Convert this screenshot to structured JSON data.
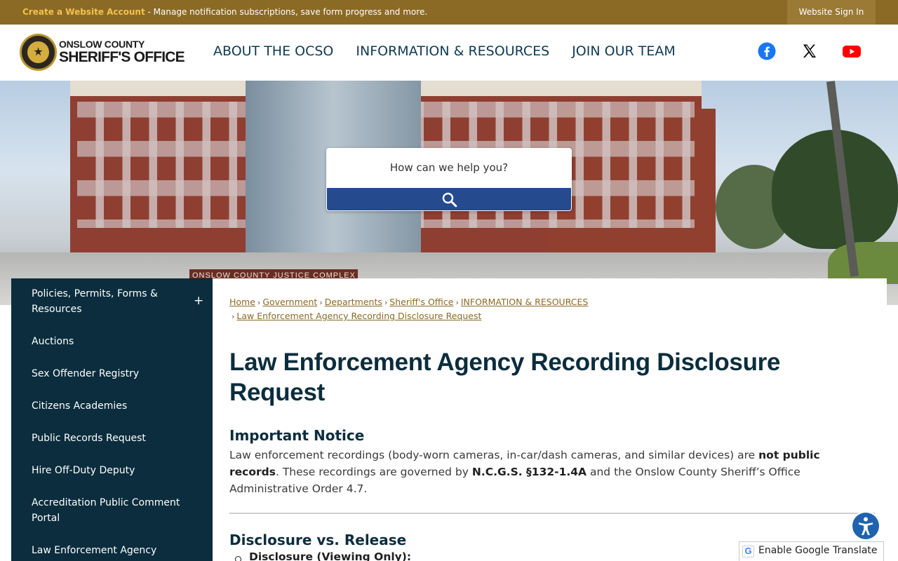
{
  "topbar": {
    "create_link": "Create a Website Account",
    "create_rest": " - Manage notification subscriptions, save form progress and more.",
    "signin_label": "Website Sign In"
  },
  "header": {
    "logo_line1": "ONSLOW COUNTY",
    "logo_line2": "SHERIFF'S OFFICE",
    "nav": [
      {
        "label": "ABOUT THE OCSO"
      },
      {
        "label": "INFORMATION & RESOURCES"
      },
      {
        "label": "JOIN OUR TEAM"
      }
    ],
    "social": [
      "facebook-icon",
      "x-icon",
      "youtube-icon"
    ],
    "colors": {
      "facebook": "#1877f2",
      "youtube": "#ff0000",
      "x": "#000000"
    }
  },
  "hero": {
    "sign_text": "ONSLOW COUNTY JUSTICE COMPLEX"
  },
  "search": {
    "placeholder": "How can we help you?",
    "icon": "search-icon"
  },
  "sidebar": {
    "items": [
      {
        "label": "Policies, Permits, Forms & Resources",
        "expandable": "+"
      },
      {
        "label": "Auctions"
      },
      {
        "label": "Sex Offender Registry"
      },
      {
        "label": "Citizens Academies"
      },
      {
        "label": "Public Records Request"
      },
      {
        "label": "Hire Off-Duty Deputy"
      },
      {
        "label": "Accreditation Public Comment Portal"
      },
      {
        "label": "Law Enforcement Agency"
      }
    ]
  },
  "breadcrumbs": [
    {
      "label": "Home"
    },
    {
      "label": "Government"
    },
    {
      "label": "Departments"
    },
    {
      "label": "Sheriff's Office"
    },
    {
      "label": "INFORMATION & RESOURCES"
    },
    {
      "label": "Law Enforcement Agency Recording Disclosure Request"
    }
  ],
  "main": {
    "title": "Law Enforcement Agency Recording Disclosure Request",
    "notice_heading": "Important Notice",
    "notice_p1": "Law enforcement recordings (body-worn cameras, in-car/dash cameras, and similar devices) are ",
    "notice_b1": "not public records",
    "notice_p2": ". These recordings are governed by ",
    "notice_b2": "N.C.G.S. §132-1.4A",
    "notice_p3": " and the Onslow County Sheriff’s Office Administrative Order 4.7.",
    "disclosure_heading": "Disclosure vs. Release",
    "disclosure_item": "Disclosure (Viewing Only):"
  },
  "widgets": {
    "accessibility_icon": "accessibility-icon",
    "translate_label": "Enable Google Translate",
    "translate_logo": "G",
    "accent_blue": "#254a8e",
    "sidebar_bg": "#0b2d3d",
    "topbar_bg": "#8b6a25"
  }
}
